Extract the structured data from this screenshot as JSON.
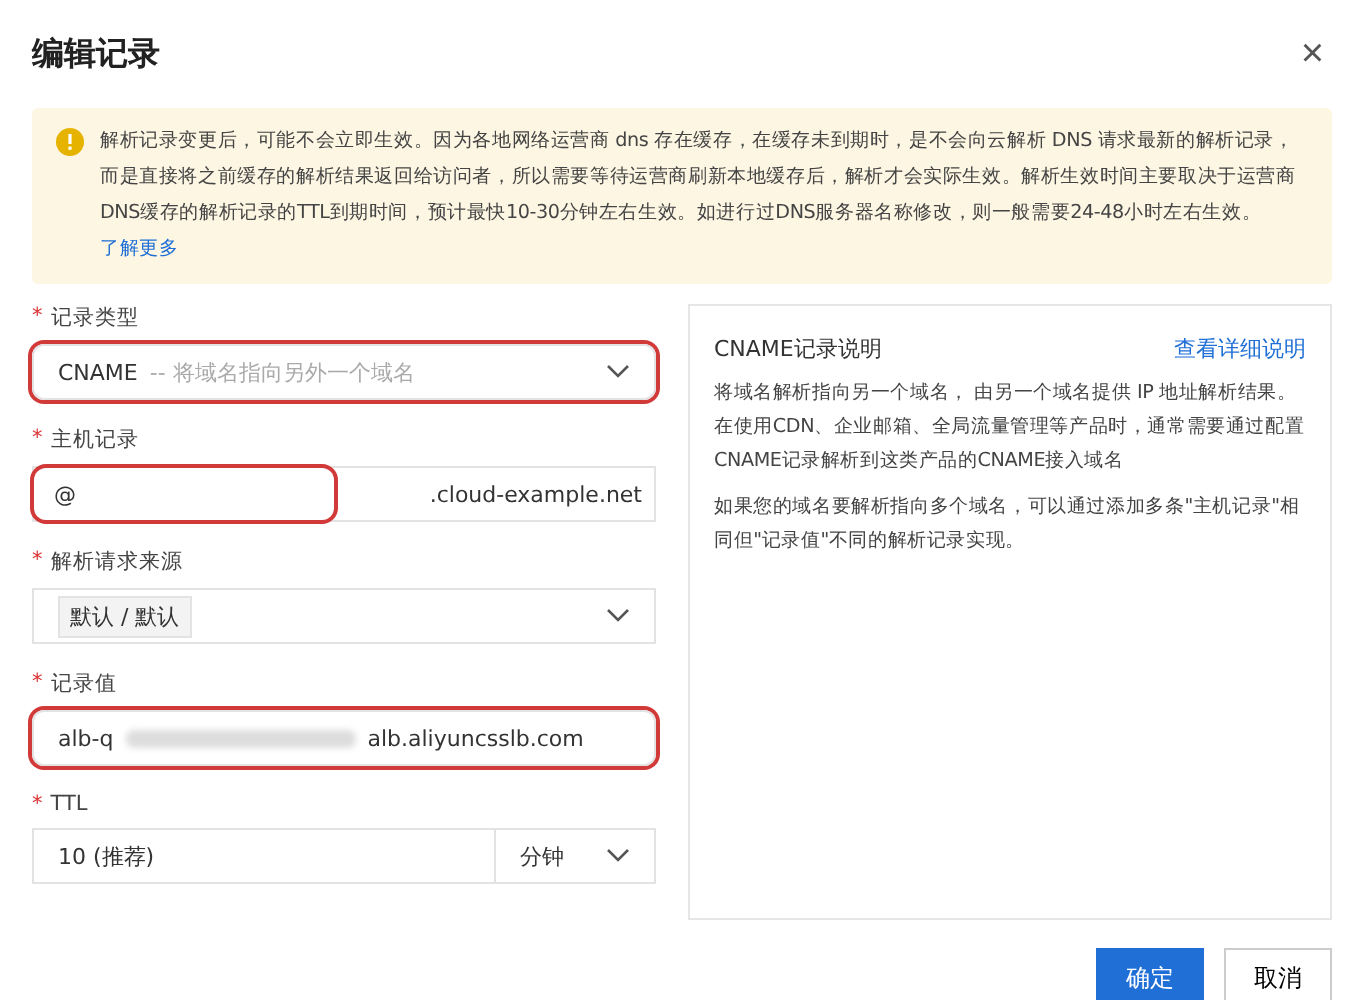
{
  "dialog": {
    "title": "编辑记录",
    "close_icon": "×"
  },
  "alert": {
    "text": "解析记录变更后，可能不会立即生效。因为各地网络运营商 dns 存在缓存，在缓存未到期时，是不会向云解析 DNS 请求最新的解析记录，而是直接将之前缓存的解析结果返回给访问者，所以需要等待运营商刷新本地缓存后，解析才会实际生效。解析生效时间主要取决于运营商DNS缓存的解析记录的TTL到期时间，预计最快10-30分钟左右生效。如进行过DNS服务器名称修改，则一般需要24-48小时左右生效。",
    "link": "了解更多"
  },
  "form": [
    {
      "kind": "select",
      "label": "记录类型",
      "required": "*",
      "value": "CNAME",
      "hint": "-- 将域名指向另外一个域名",
      "highlighted": true
    },
    {
      "kind": "suffix",
      "label": "主机记录",
      "required": "*",
      "value": "@",
      "suffix": ".cloud-example.net",
      "highlighted": true
    },
    {
      "kind": "select",
      "label": "解析请求来源",
      "required": "*",
      "value": "默认 / 默认",
      "highlighted": false,
      "tag": true
    },
    {
      "kind": "redacted",
      "label": "记录值",
      "required": "*",
      "value": "alb-q",
      "suffix": "alb.aliyuncsslb.com",
      "highlighted": true
    },
    {
      "kind": "ttl",
      "label": "TTL",
      "required": "*",
      "value": "10 (推荐)",
      "unit": "分钟",
      "highlighted": false
    }
  ],
  "help": {
    "title": "CNAME记录说明",
    "link": "查看详细说明",
    "paragraphs": [
      "将域名解析指向另一个域名， 由另一个域名提供 IP 地址解析结果。在使用CDN、企业邮箱、全局流量管理等产品时，通常需要通过配置CNAME记录解析到这类产品的CNAME接入域名",
      "如果您的域名要解析指向多个域名，可以通过添加多条\"主机记录\"相同但\"记录值\"不同的解析记录实现。"
    ]
  },
  "buttons": [
    {
      "label": "确定",
      "primary": true
    },
    {
      "label": "取消",
      "primary": false
    }
  ]
}
